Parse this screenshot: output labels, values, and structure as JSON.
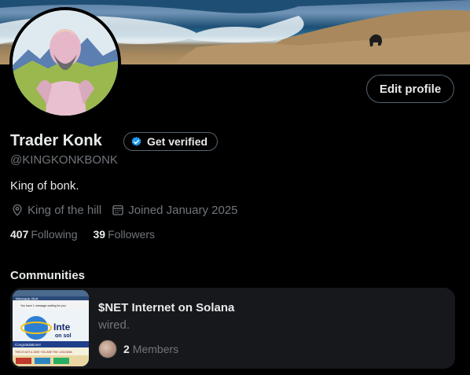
{
  "profile": {
    "display_name": "Trader Konk",
    "handle": "@KINGKONKBONK",
    "bio": "King of bonk.",
    "location": "King of the hill",
    "joined": "Joined January 2025",
    "following_count": "407",
    "following_label": "Following",
    "followers_count": "39",
    "followers_label": "Followers"
  },
  "actions": {
    "edit_profile": "Edit profile",
    "get_verified": "Get verified"
  },
  "communities": {
    "title": "Communities",
    "items": [
      {
        "name": "$NET Internet on Solana",
        "description": "wired.",
        "member_count": "2",
        "member_label": "Members",
        "thumb_text": {
          "window_title": "Message Alert",
          "message": "You have 1 message waiting for you",
          "big": "Inte",
          "big2": "on sol",
          "congrats": "Congratulations!",
          "footer": "THIS IS NOT A JOKE  YOU ARE THE 1,000,000th"
        }
      }
    ]
  },
  "icons": {
    "location": "location-pin-icon",
    "calendar": "calendar-icon",
    "verified": "verified-badge-icon"
  },
  "colors": {
    "background": "#000000",
    "text_primary": "#e7e9ea",
    "text_secondary": "#71767b",
    "border": "#536471",
    "verified_blue": "#1d9bf0",
    "card_bg": "#16181c"
  }
}
